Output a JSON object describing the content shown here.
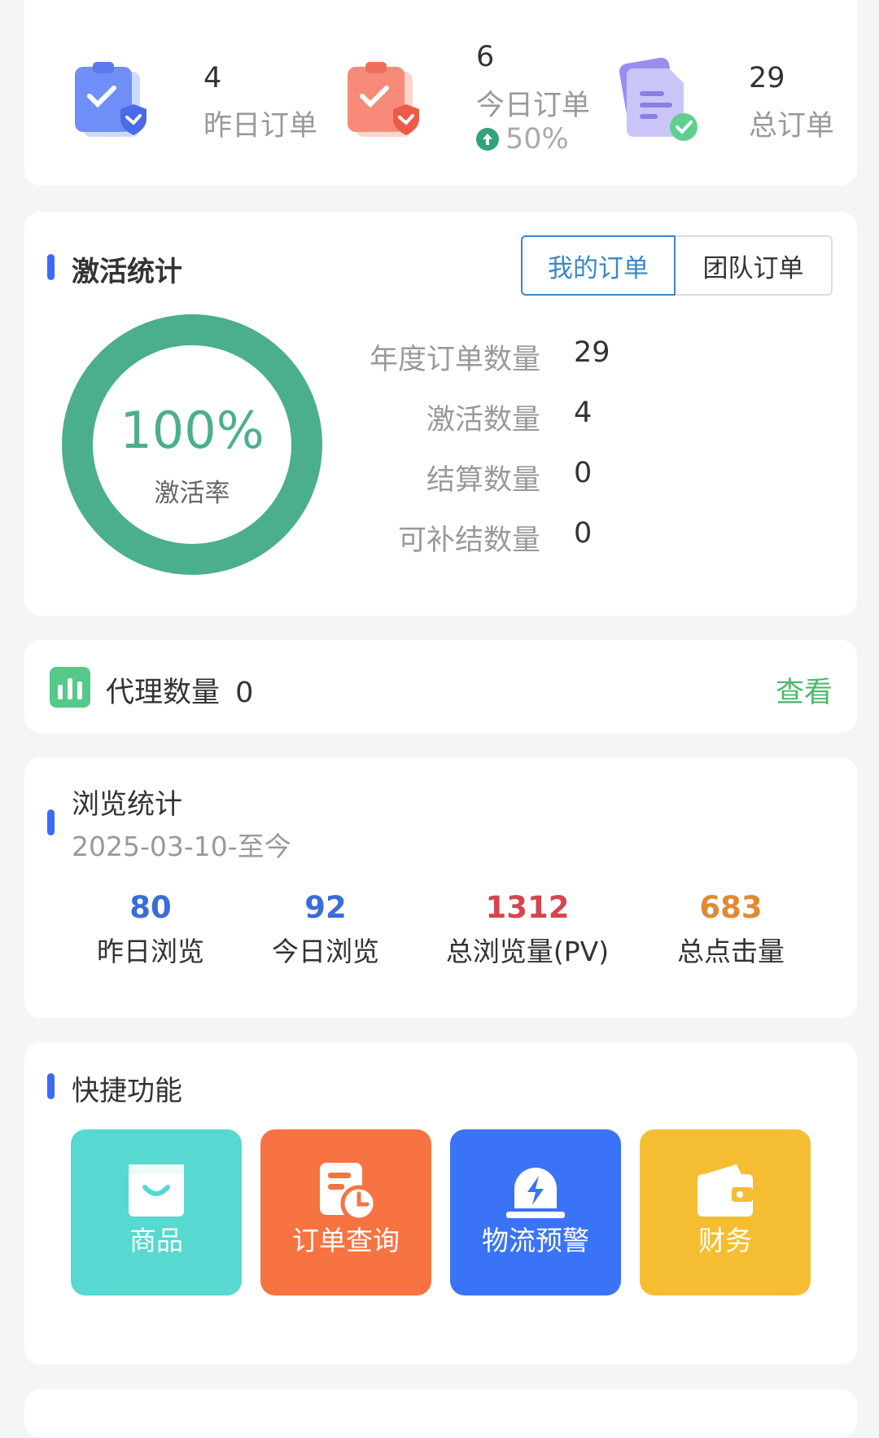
{
  "orders": [
    {
      "value": "4",
      "label": "昨日订单",
      "icon": "clipboard-check-blue-icon"
    },
    {
      "value": "6",
      "label": "今日订单",
      "trend": "50%",
      "trend_icon": "arrow-up-circle-icon",
      "icon": "clipboard-check-red-icon"
    },
    {
      "value": "29",
      "label": "总订单",
      "icon": "document-check-purple-icon"
    }
  ],
  "activation": {
    "title": "激活统计",
    "tabs": {
      "mine": "我的订单",
      "team": "团队订单",
      "selected": "mine"
    },
    "rate": "100%",
    "rate_fraction": 1.0,
    "rate_label": "激活率",
    "rows": [
      {
        "label": "年度订单数量",
        "value": "29"
      },
      {
        "label": "激活数量",
        "value": "4"
      },
      {
        "label": "结算数量",
        "value": "0"
      },
      {
        "label": "可补结数量",
        "value": "0"
      }
    ],
    "ring_color": "#4caf8c"
  },
  "agent": {
    "label": "代理数量",
    "count": "0",
    "link": "查看",
    "icon": "bar-chart-icon"
  },
  "browse": {
    "title": "浏览统计",
    "date_range": "2025-03-10-至今",
    "stats": [
      {
        "value": "80",
        "label": "昨日浏览",
        "color": "#3b6cd9"
      },
      {
        "value": "92",
        "label": "今日浏览",
        "color": "#3b6cd9"
      },
      {
        "value": "1312",
        "label": "总浏览量(PV)",
        "color": "#d6454f"
      },
      {
        "value": "683",
        "label": "总点击量",
        "color": "#e08a33"
      }
    ]
  },
  "quick": {
    "title": "快捷功能",
    "items": [
      {
        "label": "商品",
        "icon": "shopping-bag-icon",
        "color": "#57d8d0"
      },
      {
        "label": "订单查询",
        "icon": "order-clock-icon",
        "color": "#f77342"
      },
      {
        "label": "物流预警",
        "icon": "alarm-light-icon",
        "color": "#3a73f6"
      },
      {
        "label": "财务",
        "icon": "wallet-icon",
        "color": "#f5bd32"
      }
    ]
  }
}
